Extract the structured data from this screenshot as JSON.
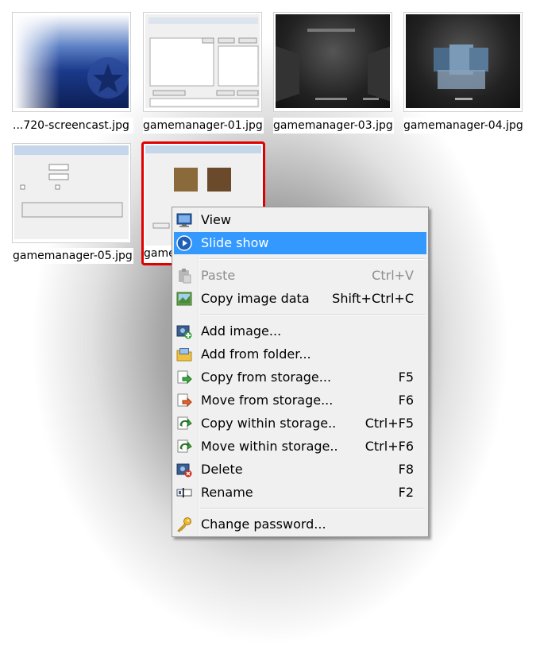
{
  "thumbnails": [
    {
      "caption": "...720-screencast.jpg"
    },
    {
      "caption": "gamemanager-01.jpg"
    },
    {
      "caption": "gamemanager-03.jpg"
    },
    {
      "caption": "gamemanager-04.jpg"
    },
    {
      "caption": "gamemanager-05.jpg"
    },
    {
      "caption": "game"
    }
  ],
  "menu": {
    "items": [
      {
        "label": "View",
        "shortcut": "",
        "icon": "monitor-icon"
      },
      {
        "label": "Slide show",
        "shortcut": "",
        "icon": "play-icon"
      },
      {
        "label": "Paste",
        "shortcut": "Ctrl+V",
        "icon": "paste-icon"
      },
      {
        "label": "Copy image data",
        "shortcut": "Shift+Ctrl+C",
        "icon": "image-icon"
      },
      {
        "label": "Add image...",
        "shortcut": "",
        "icon": "add-image-icon"
      },
      {
        "label": "Add from folder...",
        "shortcut": "",
        "icon": "folder-icon"
      },
      {
        "label": "Copy from storage...",
        "shortcut": "F5",
        "icon": "copy-arrow-icon"
      },
      {
        "label": "Move from storage...",
        "shortcut": "F6",
        "icon": "move-arrow-icon"
      },
      {
        "label": "Copy within storage..",
        "shortcut": "Ctrl+F5",
        "icon": "copy-within-icon"
      },
      {
        "label": "Move within storage..",
        "shortcut": "Ctrl+F6",
        "icon": "move-within-icon"
      },
      {
        "label": "Delete",
        "shortcut": "F8",
        "icon": "delete-icon"
      },
      {
        "label": "Rename",
        "shortcut": "F2",
        "icon": "rename-icon"
      },
      {
        "label": "Change password...",
        "shortcut": "",
        "icon": "key-icon"
      }
    ]
  },
  "colors": {
    "highlight": "#3399ff",
    "selection_border": "#e00000",
    "disabled_text": "#8d8d8d"
  }
}
